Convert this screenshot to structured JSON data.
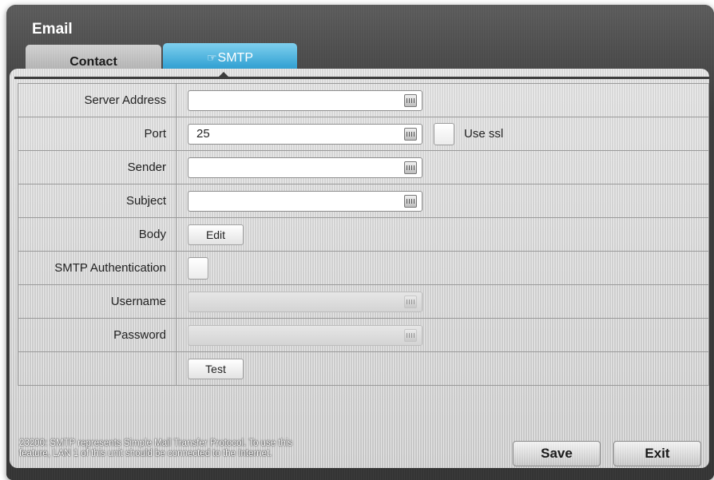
{
  "window": {
    "title": "Email"
  },
  "tabs": [
    {
      "label": "Contact",
      "active": false
    },
    {
      "label": "SMTP",
      "active": true
    }
  ],
  "form": {
    "server_address": {
      "label": "Server Address",
      "value": ""
    },
    "port": {
      "label": "Port",
      "value": "25",
      "use_ssl_label": "Use ssl",
      "use_ssl_checked": false
    },
    "sender": {
      "label": "Sender",
      "value": ""
    },
    "subject": {
      "label": "Subject",
      "value": ""
    },
    "body": {
      "label": "Body",
      "button": "Edit"
    },
    "smtp_auth": {
      "label": "SMTP Authentication",
      "checked": false
    },
    "username": {
      "label": "Username",
      "value": "",
      "disabled": true
    },
    "password": {
      "label": "Password",
      "value": "",
      "disabled": true
    },
    "test_button": "Test"
  },
  "footer": {
    "note_line1": "23200: SMTP represents Simple Mail Transfer Protocol. To use this",
    "note_line2": "feature, LAN 1 of this unit should be connected to the Internet.",
    "save_label": "Save",
    "exit_label": "Exit"
  },
  "icons": {
    "keyboard": "keyboard-icon",
    "cursor": "pointer-cursor-icon"
  },
  "colors": {
    "active_tab": "#3aa6d6",
    "window_dark": "#3a3a3a",
    "panel": "#d0d0d0"
  }
}
